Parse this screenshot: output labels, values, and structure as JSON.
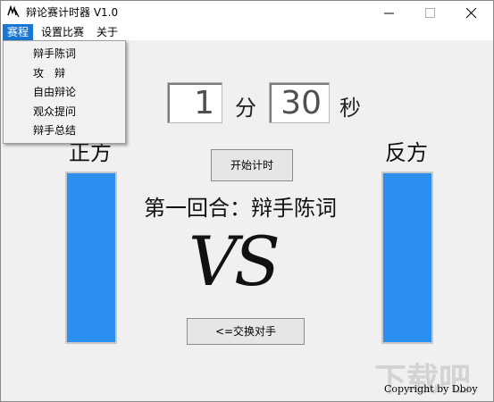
{
  "window": {
    "title": "辩论赛计时器 V1.0"
  },
  "menu": {
    "items": [
      "赛程",
      "设置比赛",
      "关于"
    ]
  },
  "dropdown": {
    "items": [
      "辩手陈词",
      "攻　辩",
      "自由辩论",
      "观众提问",
      "辩手总结"
    ]
  },
  "timer": {
    "minutes": "1",
    "minutes_unit": "分",
    "seconds": "30",
    "seconds_unit": "秒"
  },
  "sides": {
    "left": "正方",
    "right": "反方",
    "left_level": 1.0,
    "right_level": 1.0,
    "bar_color": "#2b8ff0"
  },
  "buttons": {
    "start": "开始计时",
    "swap": "<=交换对手"
  },
  "round": {
    "label": "第一回合：辩手陈词"
  },
  "vs_text": "VS",
  "copyright": "Copyright by Dboy",
  "watermark": "下载吧"
}
